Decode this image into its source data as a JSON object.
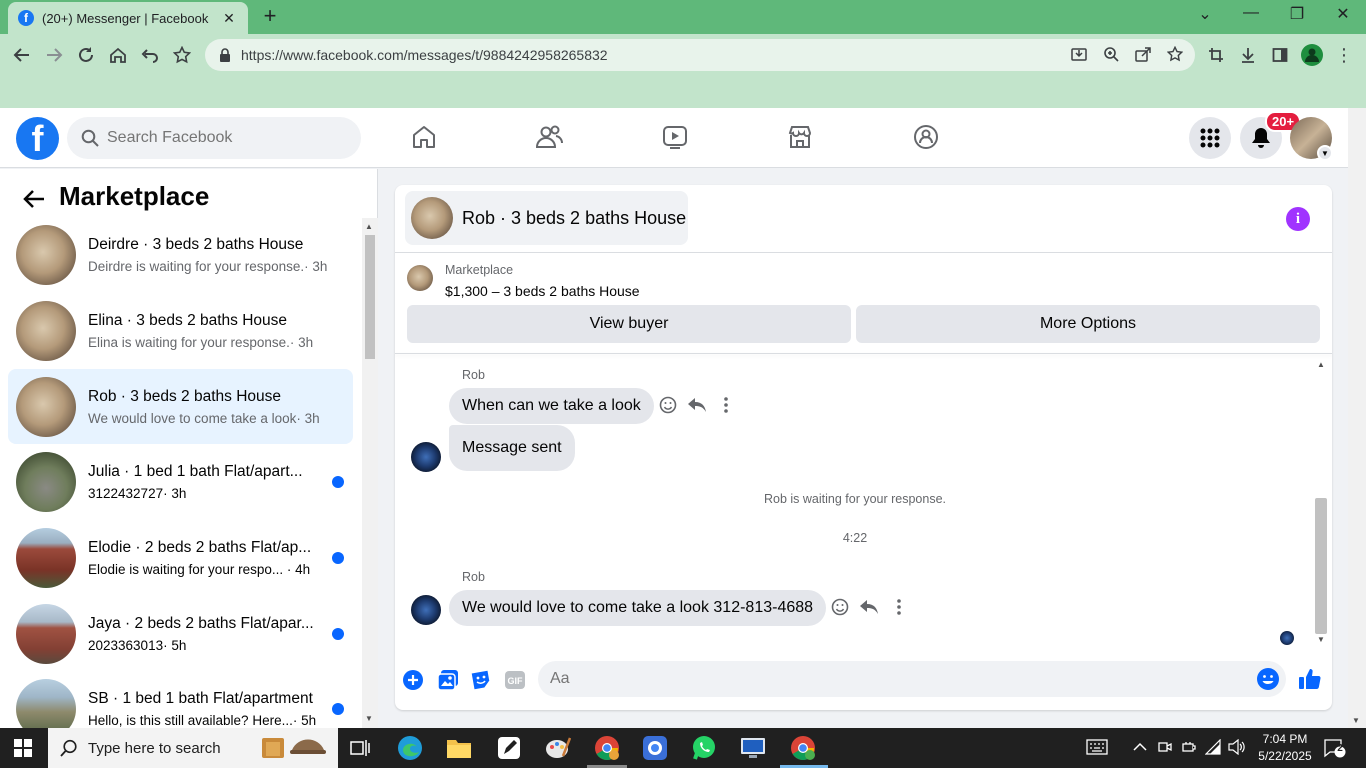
{
  "browser": {
    "tab_title": "(20+) Messenger | Facebook",
    "url": "https://www.facebook.com/messages/t/9884242958265832"
  },
  "header": {
    "search_placeholder": "Search Facebook",
    "notification_count": "20+"
  },
  "sidebar": {
    "title": "Marketplace",
    "conversations": [
      {
        "name": "Deirdre · 3 beds 2 baths House",
        "snippet": "Deirdre is waiting for your response.",
        "time": "· 3h",
        "unread": false,
        "active": false,
        "pic": "room"
      },
      {
        "name": "Elina · 3 beds 2 baths House",
        "snippet": "Elina is waiting for your response.",
        "time": "· 3h",
        "unread": false,
        "active": false,
        "pic": "room"
      },
      {
        "name": "Rob · 3 beds 2 baths House",
        "snippet": "We would love to come take a look",
        "time": "· 3h",
        "unread": false,
        "active": true,
        "pic": "room"
      },
      {
        "name": "Julia · 1 bed 1 bath Flat/apart...",
        "snippet": "3122432727",
        "time": "· 3h",
        "unread": true,
        "active": false,
        "pic": "street"
      },
      {
        "name": "Elodie · 2 beds 2 baths Flat/ap...",
        "snippet": "Elodie is waiting for your respo...",
        "time": "· 4h",
        "unread": true,
        "active": false,
        "pic": "brick"
      },
      {
        "name": "Jaya · 2 beds 2 baths Flat/apar...",
        "snippet": "2023363013",
        "time": "· 5h",
        "unread": true,
        "active": false,
        "pic": "brick2"
      },
      {
        "name": "SB · 1 bed 1 bath Flat/apartment",
        "snippet": "Hello, is this still available? Here...",
        "time": "· 5h",
        "unread": true,
        "active": false,
        "pic": "house"
      }
    ]
  },
  "chat": {
    "header_title": "Rob · 3 beds 2 baths House",
    "marketplace_label": "Marketplace",
    "listing": "$1,300 – 3 beds 2 baths House",
    "view_buyer_label": "View buyer",
    "more_options_label": "More Options",
    "messages": {
      "sender1": "Rob",
      "msg1": "When can we take a look",
      "msg2": "Message sent",
      "system": "Rob is waiting for your response.",
      "timestamp": "4:22",
      "sender2": "Rob",
      "msg3": "We would love to come take a look 312-813-4688"
    },
    "composer_placeholder": "Aa"
  },
  "taskbar": {
    "search_placeholder": "Type here to search",
    "time": "7:04 PM",
    "date": "5/22/2025",
    "notification_count": "2"
  },
  "colors": {
    "fb_blue": "#1877f2",
    "unread_dot": "#0866ff",
    "messenger_accent": "#a033ff",
    "browser_frame": "#5fb87a"
  }
}
